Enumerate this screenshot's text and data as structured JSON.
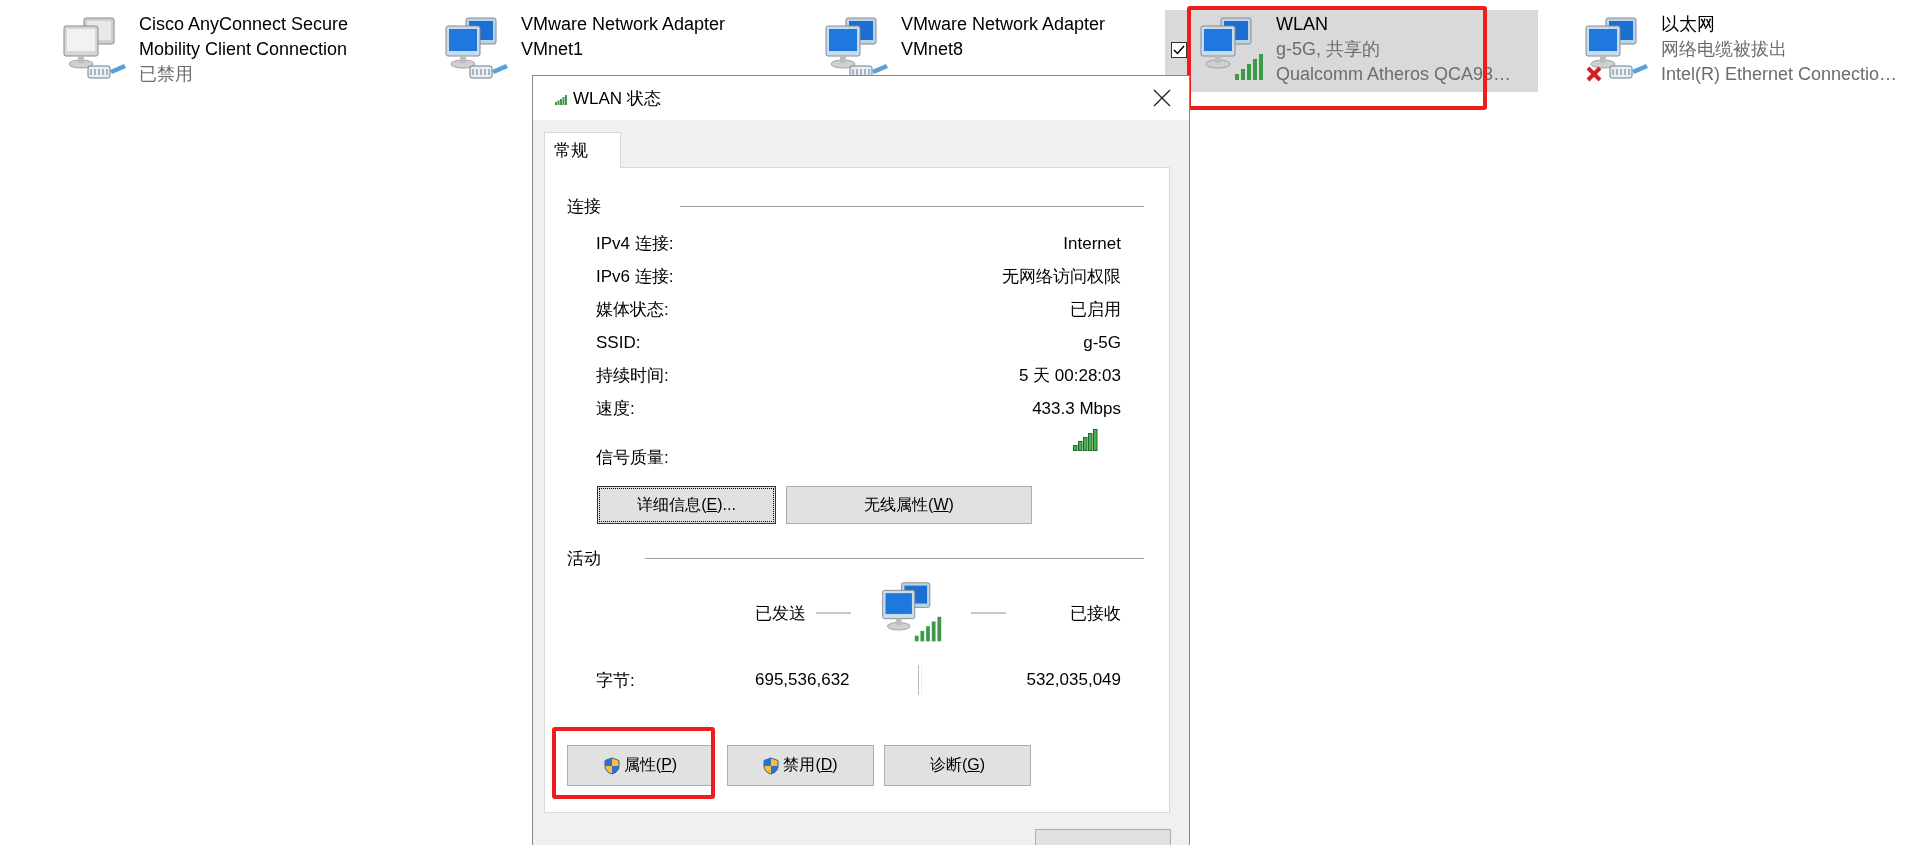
{
  "adapters": [
    {
      "kind": "disabled",
      "selected": false,
      "highlighted": false,
      "name": "Cisco AnyConnect Secure Mobility Client Connection",
      "lines": [
        "已禁用"
      ]
    },
    {
      "kind": "cable",
      "selected": false,
      "highlighted": false,
      "name": "VMware Network Adapter VMnet1"
    },
    {
      "kind": "cable",
      "selected": false,
      "highlighted": false,
      "name": "VMware Network Adapter VMnet8"
    },
    {
      "kind": "wireless",
      "selected": true,
      "highlighted": true,
      "name": "WLAN",
      "lines": [
        "g-5G, 共享的",
        "Qualcomm Atheros QCA93…"
      ]
    },
    {
      "kind": "unplugged",
      "selected": false,
      "highlighted": false,
      "name": "以太网",
      "lines": [
        "网络电缆被拔出",
        "Intel(R) Ethernet Connectio…"
      ]
    }
  ],
  "dialog": {
    "title": "WLAN 状态",
    "tabs": [
      {
        "label": "常规",
        "selected": true
      }
    ],
    "connection": {
      "heading": "连接",
      "rows": [
        {
          "label": "IPv4 连接:",
          "value": "Internet"
        },
        {
          "label": "IPv6 连接:",
          "value": "无网络访问权限"
        },
        {
          "label": "媒体状态:",
          "value": "已启用"
        },
        {
          "label": "SSID:",
          "value": "g-5G"
        },
        {
          "label": "持续时间:",
          "value": "5 天 00:28:03"
        },
        {
          "label": "速度:",
          "value": "433.3 Mbps"
        }
      ],
      "signal_label": "信号质量:",
      "buttons": [
        {
          "label": [
            "详细信息(",
            "E",
            ")..."
          ],
          "focused": true
        },
        {
          "label": [
            "无线属性(",
            "W",
            ")"
          ],
          "focused": false
        }
      ]
    },
    "activity": {
      "heading": "活动",
      "sent_label": "已发送",
      "received_label": "已接收",
      "bytes_label": "字节:",
      "sent": "695,536,632",
      "received": "532,035,049"
    },
    "buttons": [
      {
        "label": [
          "属性(",
          "P",
          ")"
        ],
        "shield": true,
        "highlighted": true
      },
      {
        "label": [
          "禁用(",
          "D",
          ")"
        ],
        "shield": true,
        "highlighted": false
      },
      {
        "label": [
          "诊断(",
          "G",
          ")"
        ],
        "shield": false,
        "highlighted": false
      }
    ]
  }
}
